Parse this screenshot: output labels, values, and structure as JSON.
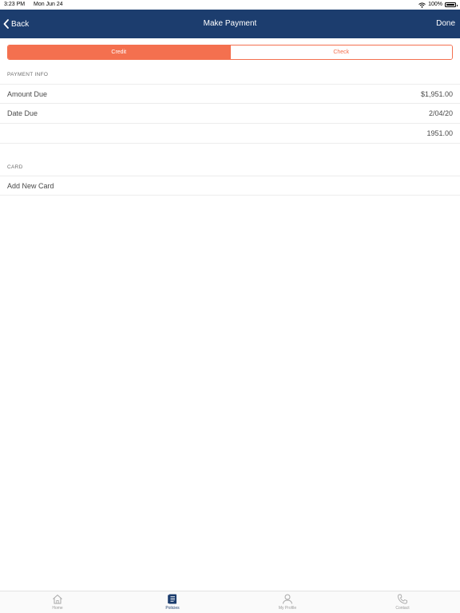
{
  "status": {
    "time": "3:23 PM",
    "date": "Mon Jun 24",
    "battery": "100%"
  },
  "nav": {
    "back_label": "Back",
    "title": "Make Payment",
    "done_label": "Done"
  },
  "segments": [
    {
      "label": "Credit",
      "selected": true
    },
    {
      "label": "Check",
      "selected": false
    }
  ],
  "payment_info": {
    "header": "PAYMENT INFO",
    "rows": [
      {
        "label": "Amount Due",
        "value": "$1,951.00"
      },
      {
        "label": "Date Due",
        "value": "2/04/20"
      },
      {
        "label": "",
        "value": "1951.00"
      }
    ]
  },
  "card": {
    "header": "CARD",
    "add_label": "Add New Card"
  },
  "tabs": [
    {
      "label": "Home",
      "icon": "home-icon",
      "active": false
    },
    {
      "label": "Policies",
      "icon": "policies-icon",
      "active": true
    },
    {
      "label": "My Profile",
      "icon": "profile-icon",
      "active": false
    },
    {
      "label": "Contact",
      "icon": "phone-icon",
      "active": false
    }
  ],
  "colors": {
    "nav": "#1c3d6e",
    "accent": "#f4704f"
  }
}
